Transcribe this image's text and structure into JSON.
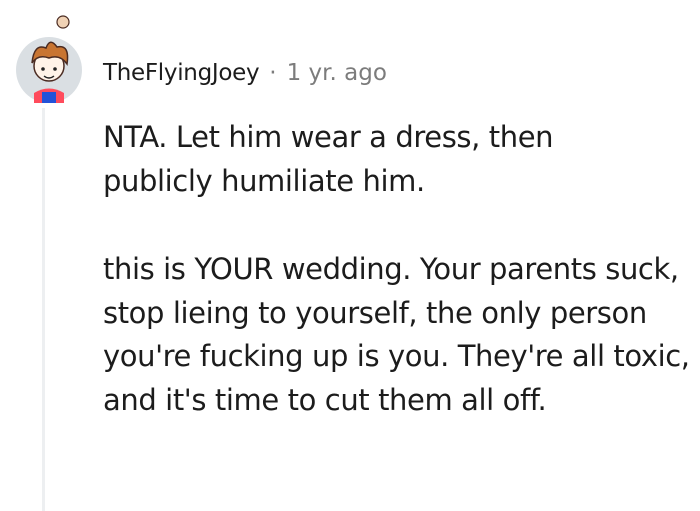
{
  "comment": {
    "avatar_icon": "cartoon-avatar-icon",
    "username": "TheFlyingJoey",
    "separator": "·",
    "timestamp": "1 yr. ago",
    "paragraphs": [
      "NTA. Let him wear a dress, then publicly humiliate him.",
      "this is YOUR wedding. Your parents suck, stop lieing to yourself, the only person you're fucking up is you. They're all toxic, and it's time to cut them all off."
    ]
  },
  "colors": {
    "text": "#1c1c1c",
    "meta": "#7c7c7c",
    "thread_line": "#edeff1",
    "avatar_background": "#dadfe3"
  }
}
